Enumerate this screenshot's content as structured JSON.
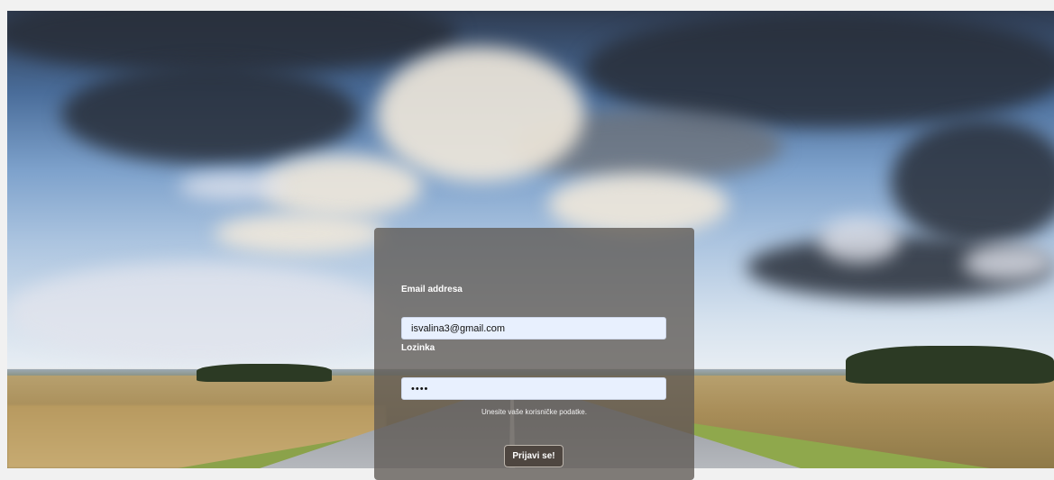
{
  "login_form": {
    "email_label": "Email addresa",
    "email_value": "isvalina3@gmail.com",
    "password_label": "Lozinka",
    "password_value": "••••",
    "hint": "Unesite vaše korisničke podatke.",
    "submit_label": "Prijavi se!"
  },
  "background": {
    "image": "sky-clouds-country-road-landscape"
  },
  "colors": {
    "card_overlay": "#5f5a54",
    "input_background": "#e8f0fe",
    "button_background": "#4e4640"
  }
}
